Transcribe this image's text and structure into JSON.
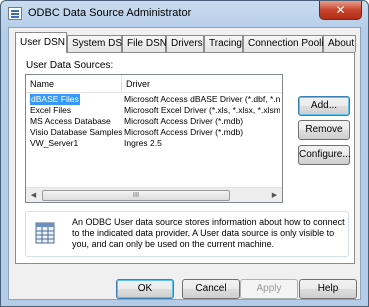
{
  "window": {
    "title": "ODBC Data Source Administrator",
    "close_glyph": "✕"
  },
  "tabs": [
    {
      "label": "User DSN"
    },
    {
      "label": "System DSN"
    },
    {
      "label": "File DSN"
    },
    {
      "label": "Drivers"
    },
    {
      "label": "Tracing"
    },
    {
      "label": "Connection Pooling"
    },
    {
      "label": "About"
    }
  ],
  "user_dsn": {
    "section_label": "User Data Sources:",
    "columns": {
      "name": "Name",
      "driver": "Driver"
    },
    "rows": [
      {
        "name": "dBASE Files",
        "driver": "Microsoft Access dBASE Driver (*.dbf, *.n"
      },
      {
        "name": "Excel Files",
        "driver": "Microsoft Excel Driver (*.xls, *.xlsx, *.xlsm,"
      },
      {
        "name": "MS Access Database",
        "driver": "Microsoft Access Driver (*.mdb)"
      },
      {
        "name": "Visio Database Samples",
        "driver": "Microsoft Access Driver (*.mdb)"
      },
      {
        "name": "VW_Server1",
        "driver": "Ingres 2.5"
      }
    ],
    "scroll_left": "◀",
    "scroll_right": "▶",
    "scroll_grip": "III",
    "buttons": {
      "add": "Add...",
      "remove": "Remove",
      "configure": "Configure..."
    },
    "info": "An ODBC User data source stores information about how to connect to the indicated data provider.   A User data source is only visible to you, and can only be used on the current machine."
  },
  "footer": {
    "ok": "OK",
    "cancel": "Cancel",
    "apply": "Apply",
    "help": "Help"
  },
  "colors": {
    "selection": "#3399ff",
    "close_button": "#c8432b"
  }
}
